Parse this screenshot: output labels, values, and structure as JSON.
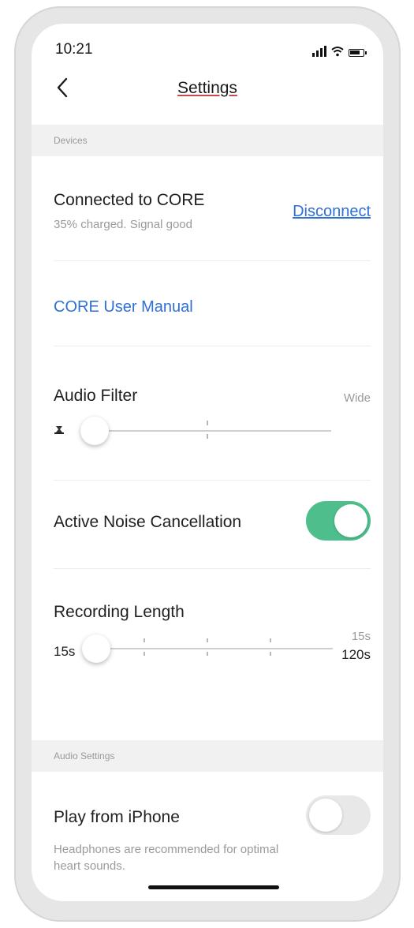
{
  "status_bar": {
    "time": "10:21",
    "signal_icon": "cellular-signal-icon",
    "wifi_icon": "wifi-icon",
    "battery_icon": "battery-icon"
  },
  "nav": {
    "title": "Settings",
    "back_icon": "chevron-left-icon"
  },
  "devices_section": {
    "header": "Devices",
    "connection": {
      "title": "Connected to CORE",
      "subtitle": "35% charged. Signal good",
      "disconnect_label": "Disconnect"
    },
    "manual_link": "CORE User Manual",
    "audio_filter": {
      "label": "Audio Filter",
      "max_label": "Wide",
      "value_fraction": 0.0
    },
    "anc": {
      "label": "Active Noise Cancellation",
      "enabled": true
    },
    "recording_length": {
      "label": "Recording Length",
      "min_label": "15s",
      "current_label": "15s",
      "max_label": "120s"
    }
  },
  "audio_section": {
    "header": "Audio Settings",
    "play_from_iphone": {
      "label": "Play from iPhone",
      "description": "Headphones are recommended for optimal heart sounds.",
      "enabled": false
    }
  },
  "colors": {
    "accent_green": "#4dbe8c",
    "link_blue": "#2f6fd6",
    "toggle_off": "#e8e8e8"
  }
}
